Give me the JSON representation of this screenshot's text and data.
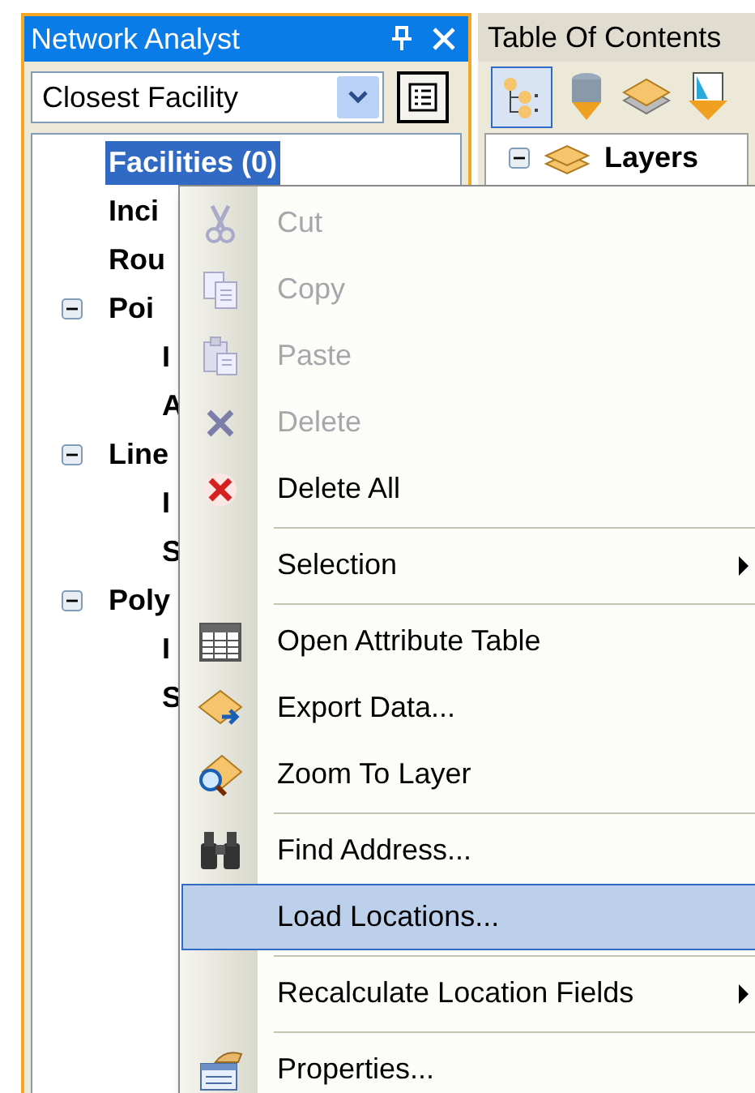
{
  "network_analyst": {
    "title": "Network Analyst",
    "solver": {
      "value": "Closest Facility"
    },
    "tree": [
      {
        "label": "Facilities (0)",
        "selected": true
      },
      {
        "label": "Inci",
        "selected": false
      },
      {
        "label": "Rou",
        "selected": false
      },
      {
        "label": "Poi",
        "selected": false,
        "expanded": true,
        "children": [
          {
            "label": "I",
            "selected": false
          },
          {
            "label": "A",
            "selected": false
          }
        ]
      },
      {
        "label": "Line",
        "selected": false,
        "expanded": true,
        "children": [
          {
            "label": "I",
            "selected": false
          },
          {
            "label": "S",
            "selected": false
          }
        ]
      },
      {
        "label": "Poly",
        "selected": false,
        "expanded": true,
        "children": [
          {
            "label": "I",
            "selected": false
          },
          {
            "label": "S",
            "selected": false
          }
        ]
      }
    ]
  },
  "table_of_contents": {
    "title": "Table Of Contents",
    "tree": [
      {
        "label": "Layers",
        "expanded": true
      }
    ]
  },
  "context_menu": [
    {
      "kind": "item",
      "label": "Cut",
      "disabled": true,
      "selected": false
    },
    {
      "kind": "item",
      "label": "Copy",
      "disabled": true,
      "selected": false
    },
    {
      "kind": "item",
      "label": "Paste",
      "disabled": true,
      "selected": false
    },
    {
      "kind": "item",
      "label": "Delete",
      "disabled": true,
      "selected": false
    },
    {
      "kind": "item",
      "label": "Delete All",
      "disabled": false,
      "selected": false
    },
    {
      "kind": "separator"
    },
    {
      "kind": "submenu",
      "label": "Selection",
      "disabled": false,
      "selected": false
    },
    {
      "kind": "separator"
    },
    {
      "kind": "item",
      "label": "Open Attribute Table",
      "disabled": false,
      "selected": false
    },
    {
      "kind": "item",
      "label": "Export Data...",
      "disabled": false,
      "selected": false
    },
    {
      "kind": "item",
      "label": "Zoom To Layer",
      "disabled": false,
      "selected": false
    },
    {
      "kind": "separator"
    },
    {
      "kind": "item",
      "label": "Find Address...",
      "disabled": false,
      "selected": false
    },
    {
      "kind": "item",
      "label": "Load Locations...",
      "disabled": false,
      "selected": true
    },
    {
      "kind": "separator"
    },
    {
      "kind": "submenu",
      "label": "Recalculate Location Fields",
      "disabled": false,
      "selected": false
    },
    {
      "kind": "separator"
    },
    {
      "kind": "item",
      "label": "Properties...",
      "disabled": false,
      "selected": false
    }
  ]
}
